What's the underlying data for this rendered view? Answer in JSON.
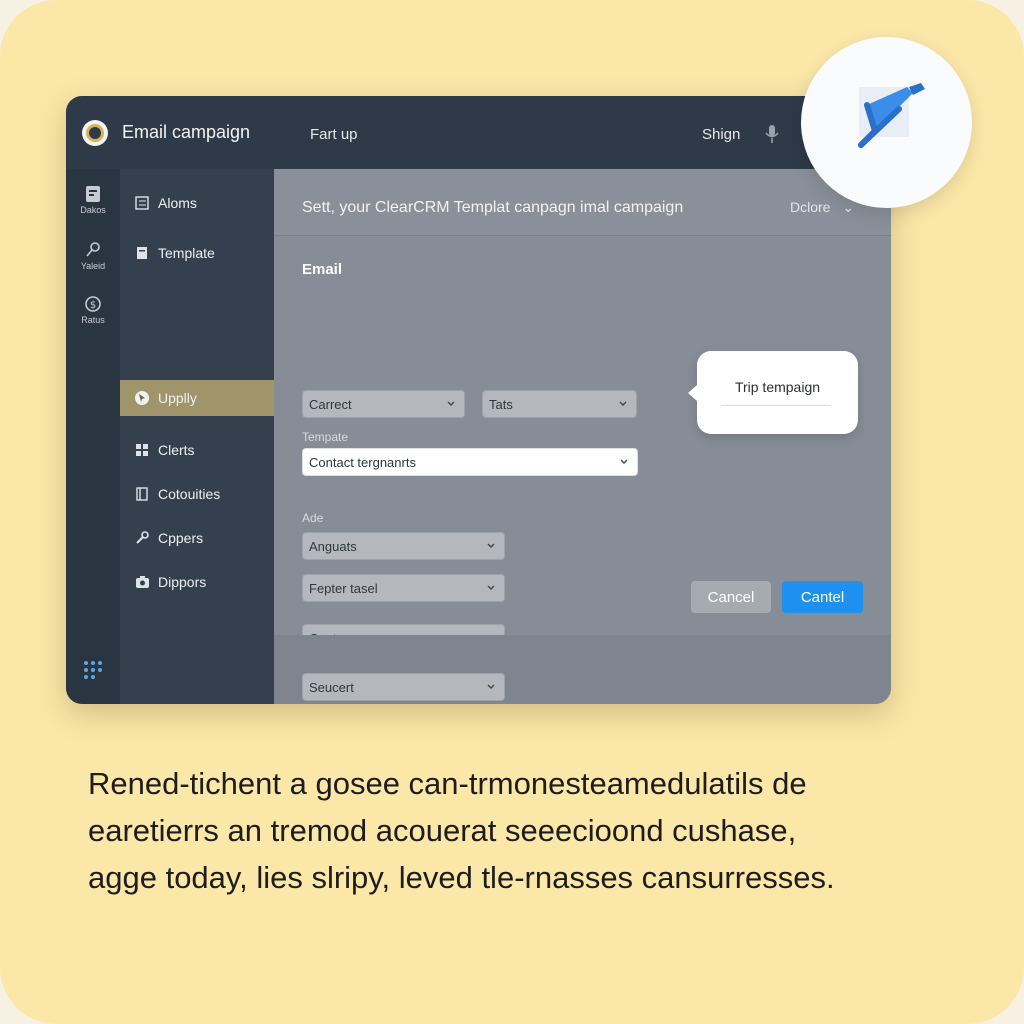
{
  "app": {
    "title": "Email campaign",
    "menu_start": "Fart up",
    "signin": "Shign"
  },
  "rail": {
    "items": [
      {
        "label": "Dakos",
        "icon": "document-icon"
      },
      {
        "label": "Yaleid",
        "icon": "link-icon"
      },
      {
        "label": "Ratus",
        "icon": "dollar-icon"
      }
    ]
  },
  "sidebar": {
    "items": [
      {
        "label": "Aloms",
        "icon": "list-icon",
        "active": false
      },
      {
        "label": "Template",
        "icon": "template-icon",
        "active": false
      },
      {
        "label": "Upplly",
        "icon": "cursor-icon",
        "active": true
      },
      {
        "label": "Clerts",
        "icon": "grid-icon",
        "active": false
      },
      {
        "label": "Cotouities",
        "icon": "book-icon",
        "active": false
      },
      {
        "label": "Cppers",
        "icon": "wrench-icon",
        "active": false
      },
      {
        "label": "Dippors",
        "icon": "camera-icon",
        "active": false
      }
    ]
  },
  "main": {
    "header": "Sett, your ClearCRM Templat canpagn imal campaign",
    "header_select": "Dclore",
    "email_label": "Email",
    "select_a": "Carrect",
    "select_b": "Tats",
    "template_label": "Tempate",
    "template_value": "Contact tergnanrts",
    "ade_label": "Ade",
    "dropdowns": [
      "Anguats",
      "Fepter tasel",
      "Contoge",
      "Seucert"
    ]
  },
  "tooltip": {
    "text": "Trip tempaign"
  },
  "buttons": {
    "cancel": "Cancel",
    "primary": "Cantel"
  },
  "caption": {
    "lines": [
      "Rened-tichent a gosee can-trmonesteamedulatils de",
      "earetierrs an tremod acouerat seeecioond cushase,",
      "agge today, lies slripy, leved tle-rnasses cansurresses."
    ]
  },
  "colors": {
    "background": "#fbe7a8",
    "titlebar": "#2e3a48",
    "sidebar": "#34404e",
    "active_item": "#a0956a",
    "primary_button": "#1e90f0"
  }
}
